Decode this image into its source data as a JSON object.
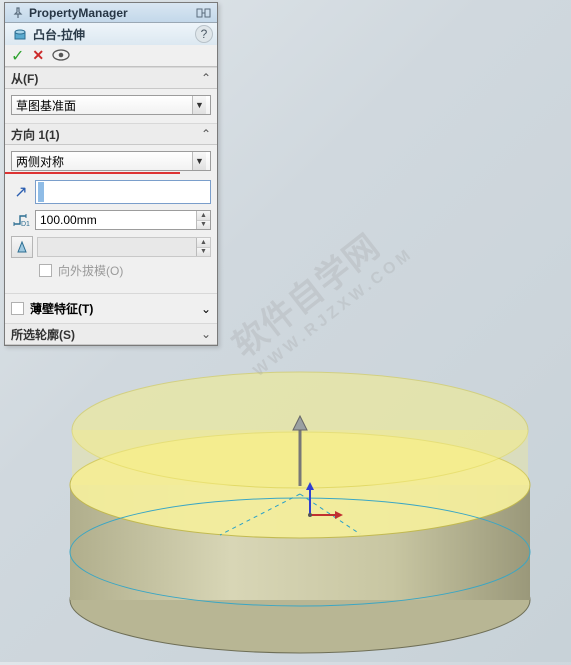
{
  "panel_title": "PropertyManager",
  "feature_name": "凸台-拉伸",
  "sections": {
    "from": {
      "label": "从(F)",
      "plane_selected": "草图基准面"
    },
    "dir1": {
      "label": "方向 1(1)",
      "end_condition": "两侧对称",
      "blind_value": "",
      "depth": "100.00mm",
      "draft_outward_label": "向外拔模(O)"
    },
    "thin": {
      "label": "薄壁特征(T)"
    },
    "contours": {
      "label": "所选轮廓(S)"
    }
  },
  "watermark": {
    "main": "软件自学网",
    "sub": "WWW.RJZXW.COM"
  }
}
